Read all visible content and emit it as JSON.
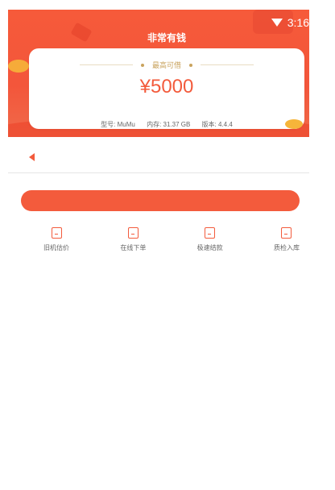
{
  "status_bar": {
    "time": "3:16"
  },
  "app": {
    "title": "非常有钱"
  },
  "quote_card": {
    "label": "最高可借",
    "amount": "¥5000",
    "device": {
      "model": "型号: MuMu",
      "storage": "内存: 31.37 GB",
      "version": "版本: 4.4.4"
    }
  },
  "notice": {
    "text": ""
  },
  "main_button": {
    "label": ""
  },
  "quick_actions": [
    {
      "label": "旧机估价",
      "icon": "phone-icon"
    },
    {
      "label": "在线下单",
      "icon": "order-icon"
    },
    {
      "label": "极速结款",
      "icon": "payment-icon"
    },
    {
      "label": "质检入库",
      "icon": "check-icon"
    }
  ],
  "colors": {
    "brand_red": "#f35b3c",
    "gold": "#c9a35e",
    "coin": "#f6b53a"
  }
}
